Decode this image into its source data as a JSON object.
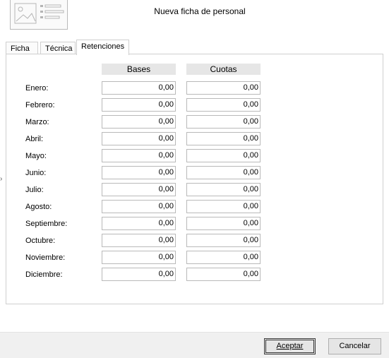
{
  "window": {
    "title": "Nueva ficha de personal"
  },
  "tabs": [
    {
      "label": "Ficha"
    },
    {
      "label": "Técnica"
    },
    {
      "label": "Retenciones"
    }
  ],
  "active_tab": "Retenciones",
  "columns": {
    "bases": "Bases",
    "cuotas": "Cuotas"
  },
  "rows": [
    {
      "month": "Enero:",
      "base": "0,00",
      "cuota": "0,00"
    },
    {
      "month": "Febrero:",
      "base": "0,00",
      "cuota": "0,00"
    },
    {
      "month": "Marzo:",
      "base": "0,00",
      "cuota": "0,00"
    },
    {
      "month": "Abril:",
      "base": "0,00",
      "cuota": "0,00"
    },
    {
      "month": "Mayo:",
      "base": "0,00",
      "cuota": "0,00"
    },
    {
      "month": "Junio:",
      "base": "0,00",
      "cuota": "0,00"
    },
    {
      "month": "Julio:",
      "base": "0,00",
      "cuota": "0,00"
    },
    {
      "month": "Agosto:",
      "base": "0,00",
      "cuota": "0,00"
    },
    {
      "month": "Septiembre:",
      "base": "0,00",
      "cuota": "0,00"
    },
    {
      "month": "Octubre:",
      "base": "0,00",
      "cuota": "0,00"
    },
    {
      "month": "Noviembre:",
      "base": "0,00",
      "cuota": "0,00"
    },
    {
      "month": "Diciembre:",
      "base": "0,00",
      "cuota": "0,00"
    }
  ],
  "buttons": {
    "accept": "Aceptar",
    "cancel": "Cancelar"
  },
  "icons": {
    "logo": "image-placeholder-icon",
    "side": "chevron-right-icon"
  }
}
